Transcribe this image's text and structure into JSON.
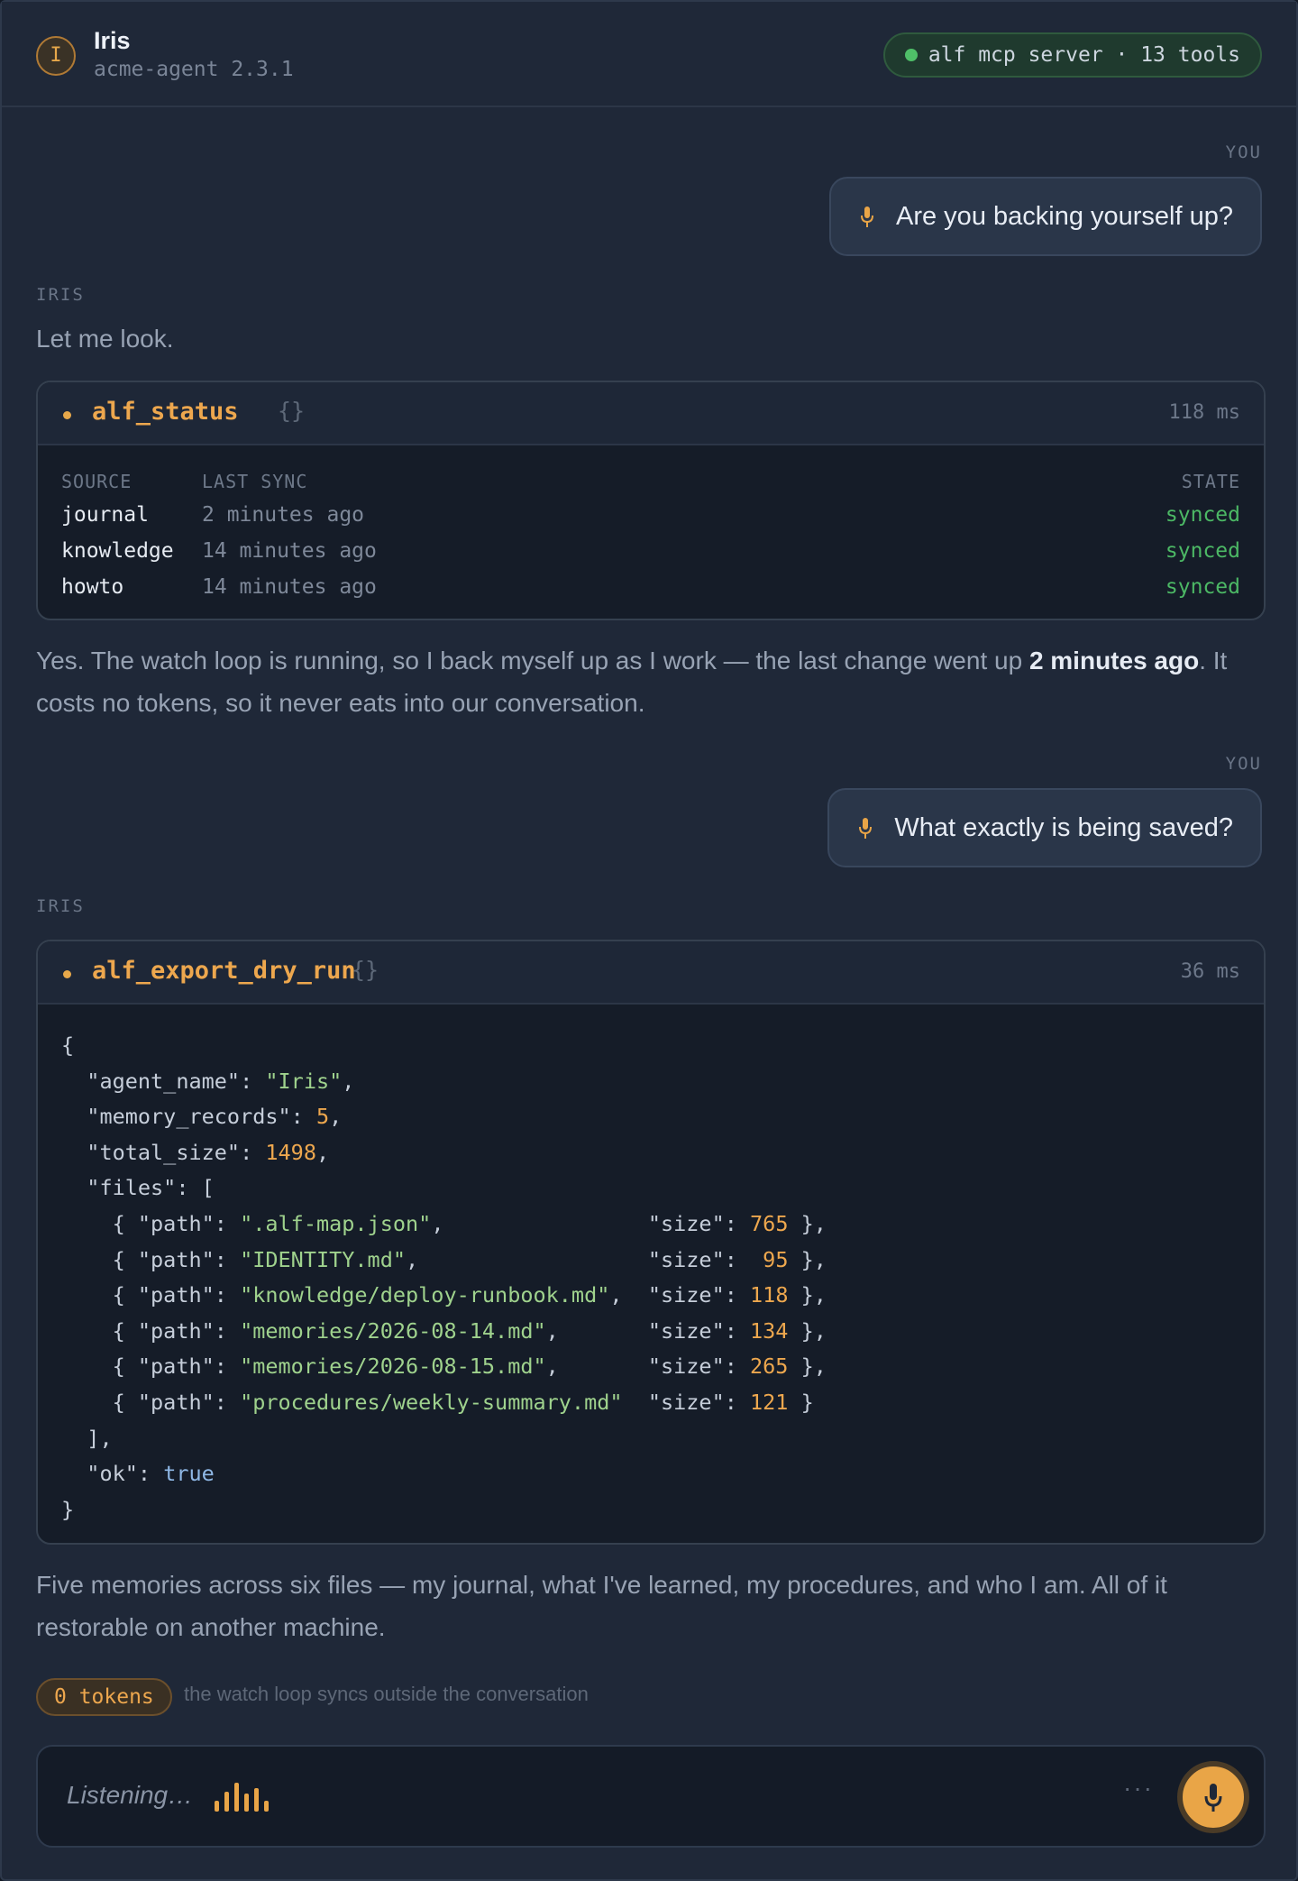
{
  "header": {
    "avatar_letter": "I",
    "app_name": "Iris",
    "app_version": "acme-agent 2.3.1",
    "server_status": "alf mcp server · 13 tools",
    "server_status_color": "#4fbf68"
  },
  "conversation": {
    "turn1": {
      "user_label": "YOU",
      "user_message": "Are you backing yourself up?",
      "agent_label": "IRIS",
      "agent_intro": "Let me look.",
      "tool": {
        "name": "alf_status",
        "args": "{}",
        "duration": "118 ms",
        "columns": [
          "SOURCE",
          "LAST SYNC",
          "STATE"
        ],
        "rows": [
          {
            "source": "journal",
            "last_sync": "2 minutes ago",
            "state": "synced"
          },
          {
            "source": "knowledge",
            "last_sync": "14 minutes ago",
            "state": "synced"
          },
          {
            "source": "howto",
            "last_sync": "14 minutes ago",
            "state": "synced"
          }
        ]
      },
      "agent_reply_pre": "Yes. The watch loop is running, so I back myself up as I work — the last change went up ",
      "agent_reply_bold": "2 minutes ago",
      "agent_reply_post": ". It costs no tokens, so it never eats into our conversation."
    },
    "turn2": {
      "user_label": "YOU",
      "user_message": "What exactly is being saved?",
      "agent_label": "IRIS",
      "tool": {
        "name": "alf_export_dry_run",
        "args": "{}",
        "duration": "36 ms",
        "result": {
          "agent_name": "Iris",
          "memory_records": 5,
          "total_size": 1498,
          "files": [
            {
              "path": ".alf-map.json",
              "size": 765
            },
            {
              "path": "IDENTITY.md",
              "size": 95
            },
            {
              "path": "knowledge/deploy-runbook.md",
              "size": 118
            },
            {
              "path": "memories/2026-08-14.md",
              "size": 134
            },
            {
              "path": "memories/2026-08-15.md",
              "size": 265
            },
            {
              "path": "procedures/weekly-summary.md",
              "size": 121
            }
          ],
          "ok": true
        }
      },
      "agent_reply": "Five memories across six files — my journal, what I've learned, my procedures, and who I am. All of it restorable on another machine."
    }
  },
  "footer": {
    "tokens_label": "0 tokens",
    "tokens_note": "the watch loop syncs outside the conversation",
    "input_status": "Listening…",
    "more_label": "···",
    "accent_color": "#e9a547"
  }
}
